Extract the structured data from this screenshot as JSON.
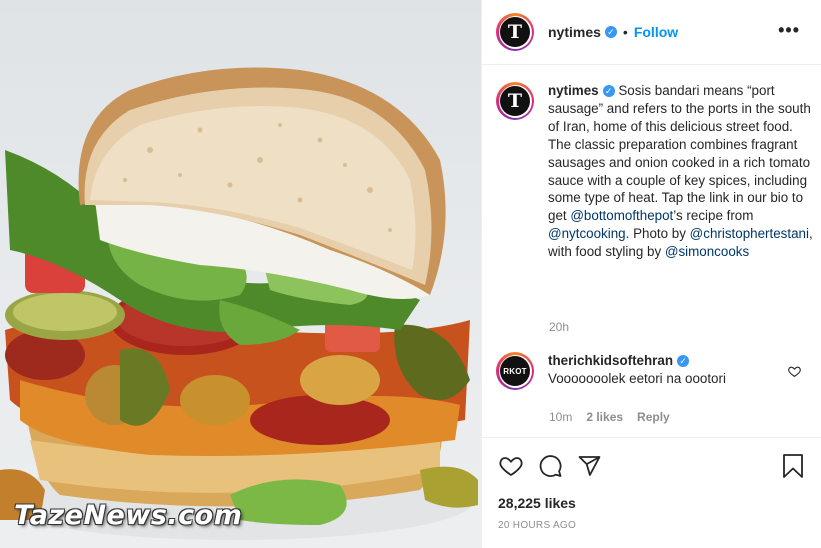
{
  "post": {
    "author": "nytimes",
    "author_avatar_glyph": "T",
    "follow_label": "Follow",
    "separator": "•",
    "more_label": "•••",
    "caption": {
      "username": "nytimes",
      "part1": " Sosis bandari means “port sausage” and refers to the ports in the south of Iran, home of this delicious street food. The classic preparation combines fragrant sausages and onion cooked in a rich tomato sauce with a couple of key spices, including some type of heat. Tap the link in our bio to get ",
      "mention1": "@bottomofthepot",
      "part2": "’s recipe from ",
      "mention2": "@nytcooking",
      "part3": ". Photo by ",
      "mention3": "@christophertestani",
      "part4": ", with food styling by ",
      "mention4": "@simoncooks"
    },
    "caption_time": "20h",
    "comment": {
      "username": "therichkidsoftehran",
      "avatar_text": "RKOT",
      "text": "Vooooooolek eetori na oootori",
      "time": "10m",
      "likes": "2 likes",
      "reply_label": "Reply"
    },
    "likes_count": "28,225 likes",
    "posted_ago": "20 HOURS AGO"
  },
  "watermark": "TazeNews.com",
  "icons": {
    "verified": "verified-badge-icon",
    "like": "heart-icon",
    "comment": "comment-bubble-icon",
    "share": "paper-plane-icon",
    "save": "bookmark-icon",
    "more": "more-options-icon"
  },
  "colors": {
    "accent": "#0095f6",
    "verified": "#3897f0",
    "text": "#262626",
    "muted": "#8e8e8e",
    "mention": "#00376b"
  }
}
